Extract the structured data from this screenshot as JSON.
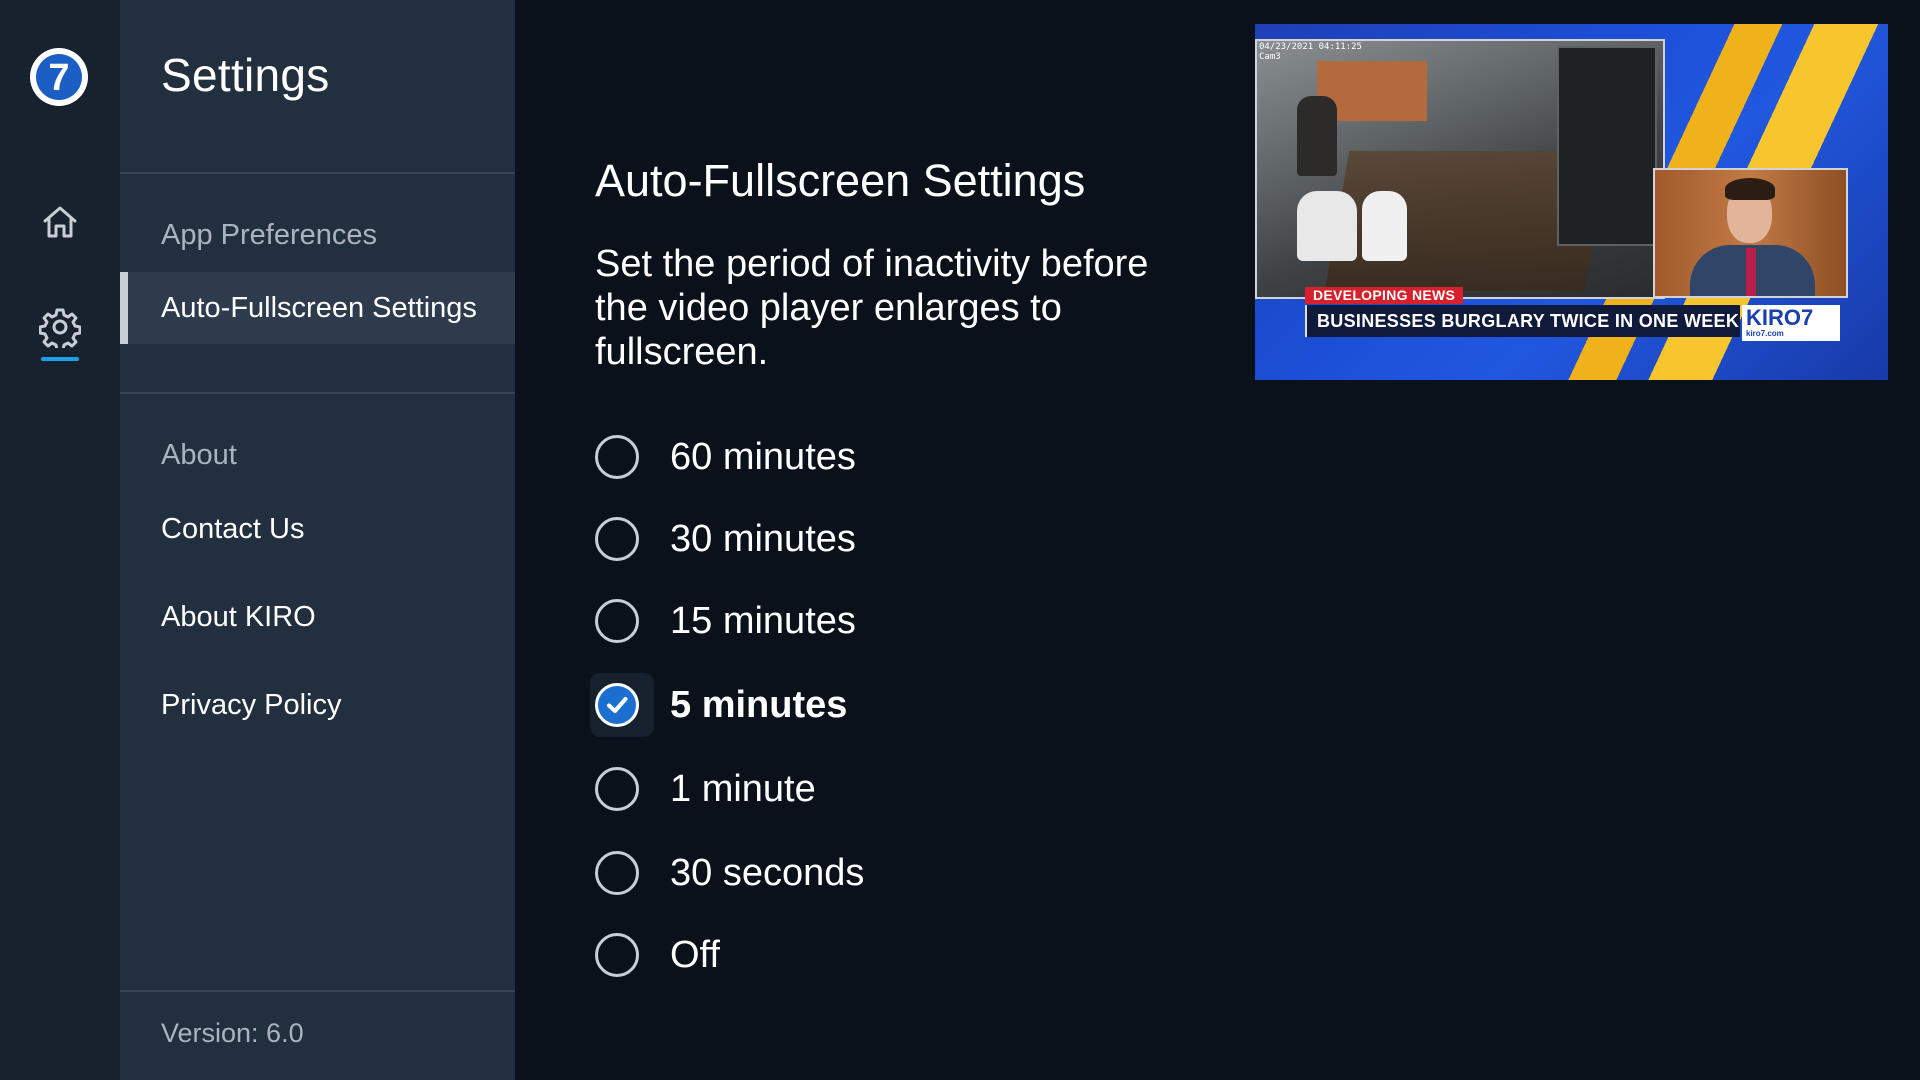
{
  "rail": {
    "logo_glyph": "7",
    "items": [
      {
        "name": "home",
        "icon": "home-icon"
      },
      {
        "name": "settings",
        "icon": "gear-icon",
        "selected": true
      }
    ],
    "accent_color": "#1aa0e8"
  },
  "menu": {
    "title": "Settings",
    "items": [
      {
        "label": "App Preferences",
        "style": "dim"
      },
      {
        "label": "Auto-Fullscreen Settings",
        "style": "active"
      },
      {
        "label": "About",
        "style": "dim"
      },
      {
        "label": "Contact Us"
      },
      {
        "label": "About KIRO"
      },
      {
        "label": "Privacy Policy"
      }
    ],
    "version": "Version: 6.0"
  },
  "content": {
    "title": "Auto-Fullscreen Settings",
    "description": "Set the period of inactivity before the video player enlarges to fullscreen.",
    "options": [
      {
        "label": "60 minutes",
        "checked": false
      },
      {
        "label": "30 minutes",
        "checked": false
      },
      {
        "label": "15 minutes",
        "checked": false
      },
      {
        "label": "5 minutes",
        "checked": true
      },
      {
        "label": "1 minute",
        "checked": false
      },
      {
        "label": "30 seconds",
        "checked": false
      },
      {
        "label": "Off",
        "checked": false
      }
    ],
    "selected_color": "#1a6fd1"
  },
  "video": {
    "cctv_timestamp": "04/23/2021 04:11:25",
    "cctv_camera": "Cam3",
    "tag": "DEVELOPING NEWS",
    "headline": "BUSINESSES BURGLARY TWICE IN ONE WEEK",
    "brand": "KIRO",
    "brand_glyph": "7",
    "brand_url": "kiro7.com"
  }
}
